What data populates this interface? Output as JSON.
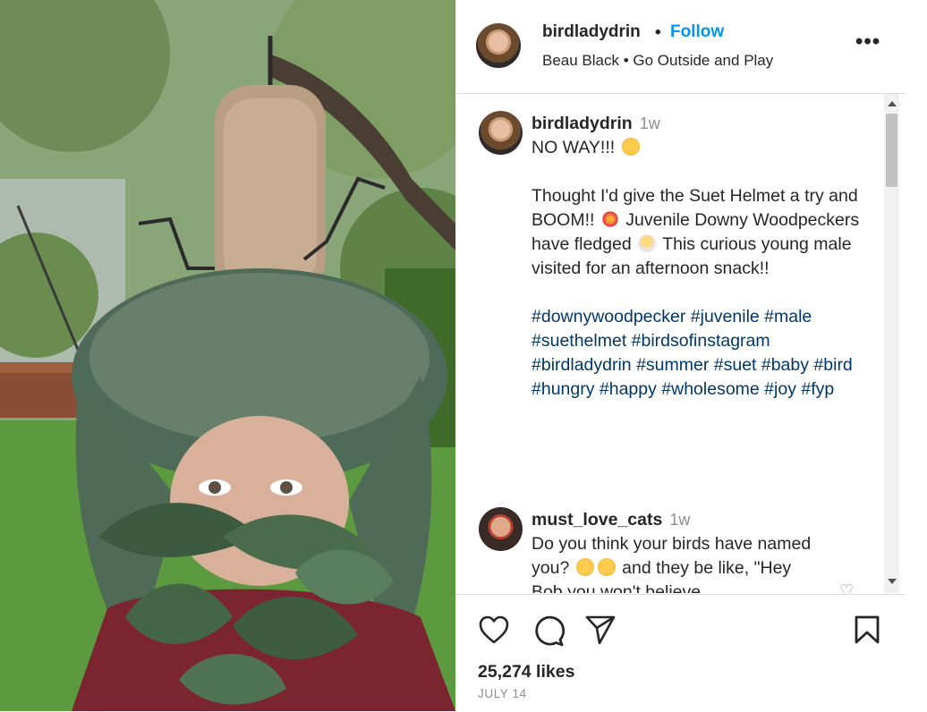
{
  "header": {
    "username": "birdladydrin",
    "separator": "•",
    "follow_label": "Follow",
    "audio": "Beau Black • Go Outside and Play",
    "more_label": "•••"
  },
  "caption": {
    "username": "birdladydrin",
    "time": "1w",
    "line1": "NO WAY!!!",
    "p1": "Thought I'd give the Suet Helmet a try and BOOM!!",
    "p2": "Juvenile Downy Woodpeckers have fledged",
    "p3": "This curious young male visited for an afternoon snack!!",
    "hashtags": "#downywoodpecker #juvenile #male #suethelmet #birdsofinstagram #birdladydrin #summer #suet #baby #bird #hungry #happy #wholesome #joy #fyp"
  },
  "comment": {
    "username": "must_love_cats",
    "time": "1w",
    "text1": "Do you think your birds have named you?",
    "text2": "and they be like, \"Hey Bob you won't believe"
  },
  "footer": {
    "likes": "25,274 likes",
    "date": "JULY 14"
  },
  "icons": [
    "heart-icon",
    "comment-icon",
    "share-icon",
    "bookmark-icon",
    "more-icon"
  ],
  "colors": {
    "follow": "#0095f6",
    "hashtag": "#00376b",
    "muted": "#8e8e8e"
  }
}
